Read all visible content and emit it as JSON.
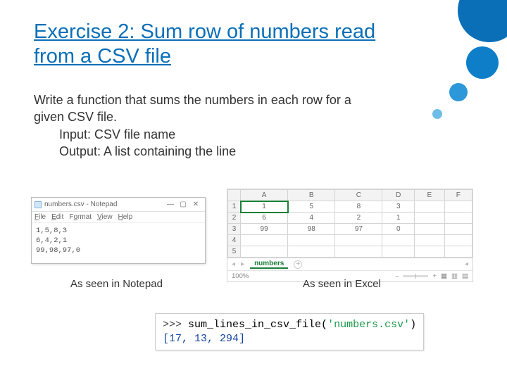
{
  "title": "Exercise 2: Sum row of numbers read from a CSV file",
  "description": {
    "line1": "Write a function that sums the numbers in each row for a given CSV file.",
    "input": "Input: CSV file name",
    "output": "Output:  A list containing the line"
  },
  "notepad": {
    "window_title": "numbers.csv - Notepad",
    "menu": {
      "file": "File",
      "edit": "Edit",
      "format": "Format",
      "view": "View",
      "help": "Help"
    },
    "content": "1,5,8,3\n6,4,2,1\n99,98,97,0"
  },
  "excel": {
    "columns": [
      "A",
      "B",
      "C",
      "D",
      "E",
      "F"
    ],
    "rows": [
      [
        "1",
        "5",
        "8",
        "3",
        "",
        ""
      ],
      [
        "6",
        "4",
        "2",
        "1",
        "",
        ""
      ],
      [
        "99",
        "98",
        "97",
        "0",
        "",
        ""
      ],
      [
        "",
        "",
        "",
        "",
        "",
        ""
      ],
      [
        "",
        "",
        "",
        "",
        "",
        ""
      ]
    ],
    "sheet_tab": "numbers",
    "zoom": "100%"
  },
  "captions": {
    "notepad": "As seen in Notepad",
    "excel": "As seen in Excel"
  },
  "code": {
    "prompt": ">>> ",
    "call": "sum_lines_in_csv_file",
    "arg": "'numbers.csv'",
    "result": "[17, 13, 294]"
  }
}
